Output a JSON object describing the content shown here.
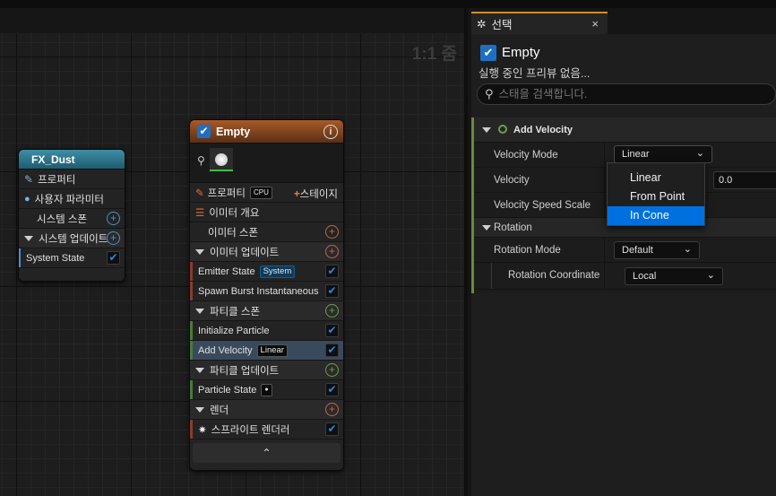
{
  "graph": {
    "zoom_label": "1:1 줌"
  },
  "fx_dust_node": {
    "title": "FX_Dust",
    "rows": {
      "properties": "프로퍼티",
      "user_params": "사용자 파라미터",
      "system_spawn": "시스템 스폰",
      "system_update": "시스템 업데이트",
      "system_state": "System State"
    }
  },
  "empty_node": {
    "title": "Empty",
    "properties_label": "프로퍼티",
    "cpu_badge": "CPU",
    "stage_button": "스테이지",
    "emitter_summary": "이미터 개요",
    "emitter_spawn": "이미터 스폰",
    "emitter_update": "이미터 업데이트",
    "emitter_state": "Emitter State",
    "emitter_state_badge": "System",
    "spawn_burst": "Spawn Burst Instantaneous",
    "particle_spawn": "파티클 스폰",
    "initialize_particle": "Initialize Particle",
    "add_velocity": "Add Velocity",
    "add_velocity_badge": "Linear",
    "particle_update": "파티클 업데이트",
    "particle_state": "Particle State",
    "render": "렌더",
    "sprite_renderer": "스프라이트 렌더러"
  },
  "selection_panel": {
    "tab_label": "선택",
    "selected_name": "Empty",
    "preview_note": "실행 중인 프리뷰 없음...",
    "search_placeholder": "스태을 검색합니다.",
    "section_title": "Add Velocity",
    "velocity_mode_label": "Velocity Mode",
    "velocity_mode_value": "Linear",
    "velocity_label": "Velocity",
    "velocity_value": "0.0",
    "velocity_speed_scale_label": "Velocity Speed Scale",
    "rotation_group": "Rotation",
    "rotation_mode_label": "Rotation Mode",
    "rotation_mode_value": "Default",
    "rotation_coordinate_label": "Rotation Coordinate",
    "rotation_coordinate_value": "Local"
  },
  "velocity_mode_dropdown": {
    "options": [
      "Linear",
      "From Point",
      "In Cone"
    ],
    "highlighted": "In Cone"
  },
  "colors": {
    "emitter_header": "#a85a28",
    "system_header": "#3f8ea6",
    "accent_blue": "#0070e0",
    "tab_accent": "#d68b2a"
  }
}
